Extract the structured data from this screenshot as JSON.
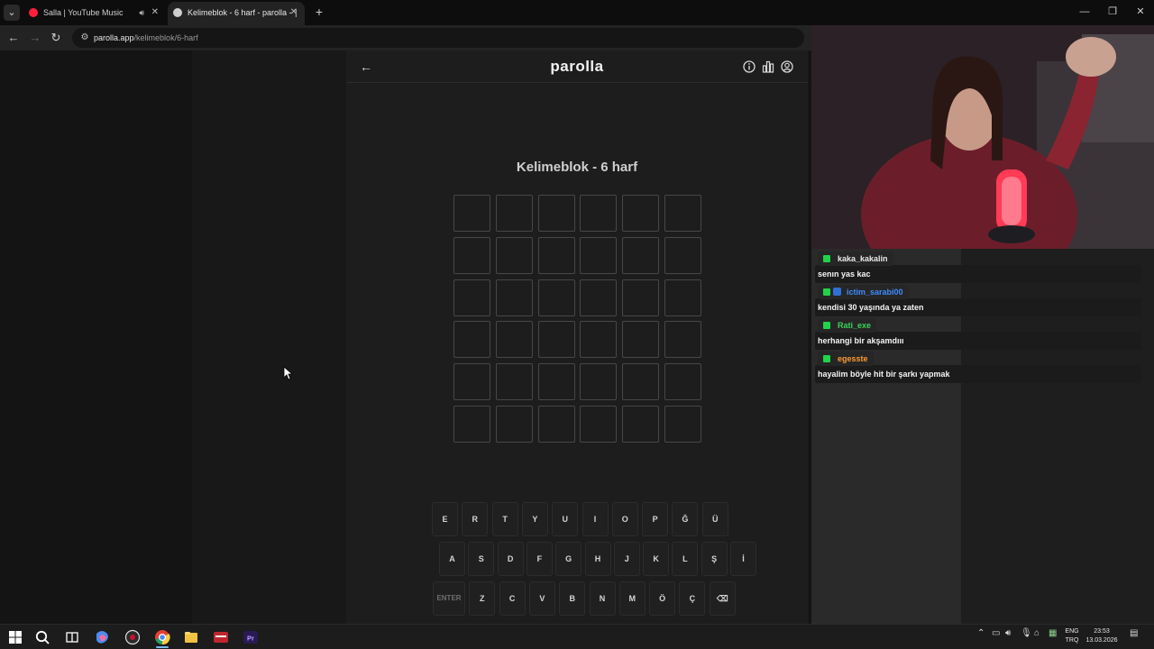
{
  "browser": {
    "tabs": [
      {
        "title": "Salla | YouTube Music",
        "active": false,
        "audio": true
      },
      {
        "title": "Kelimeblok - 6 harf - parolla - ∣",
        "active": true,
        "audio": false
      }
    ],
    "new_tab_label": "+",
    "url_host": "parolla.app",
    "url_path": "/kelimeblok/6-harf"
  },
  "app": {
    "logo": "parolla",
    "title": "Kelimeblok - 6 harf",
    "grid": {
      "rows": 6,
      "cols": 6
    },
    "keyboard": {
      "row1": [
        "E",
        "R",
        "T",
        "Y",
        "U",
        "I",
        "O",
        "P",
        "Ğ",
        "Ü"
      ],
      "row2": [
        "A",
        "S",
        "D",
        "F",
        "G",
        "H",
        "J",
        "K",
        "L",
        "Ş",
        "İ"
      ],
      "row3": [
        "ENTER",
        "Z",
        "C",
        "V",
        "B",
        "N",
        "M",
        "Ö",
        "Ç",
        "⌫"
      ]
    }
  },
  "chat": {
    "messages": [
      {
        "user": "kaka_kakalin",
        "text": "senın yas kac",
        "color": "#e8e8e8",
        "extra_badge": false
      },
      {
        "user": "ictim_sarabi00",
        "text": "kendisi 30 yaşında ya zaten",
        "color": "#3f8cff",
        "extra_badge": true
      },
      {
        "user": "Rati_exe",
        "text": "herhangi bir akşamdııı",
        "color": "#39d45a",
        "extra_badge": false
      },
      {
        "user": "egesste",
        "text": "hayalim böyle hit bir şarkı yapmak",
        "color": "#ff9a2e",
        "extra_badge": false
      }
    ]
  },
  "taskbar": {
    "language_top": "ENG",
    "language_bottom": "TRQ",
    "time": "23:53",
    "date": "13.03.2026"
  }
}
